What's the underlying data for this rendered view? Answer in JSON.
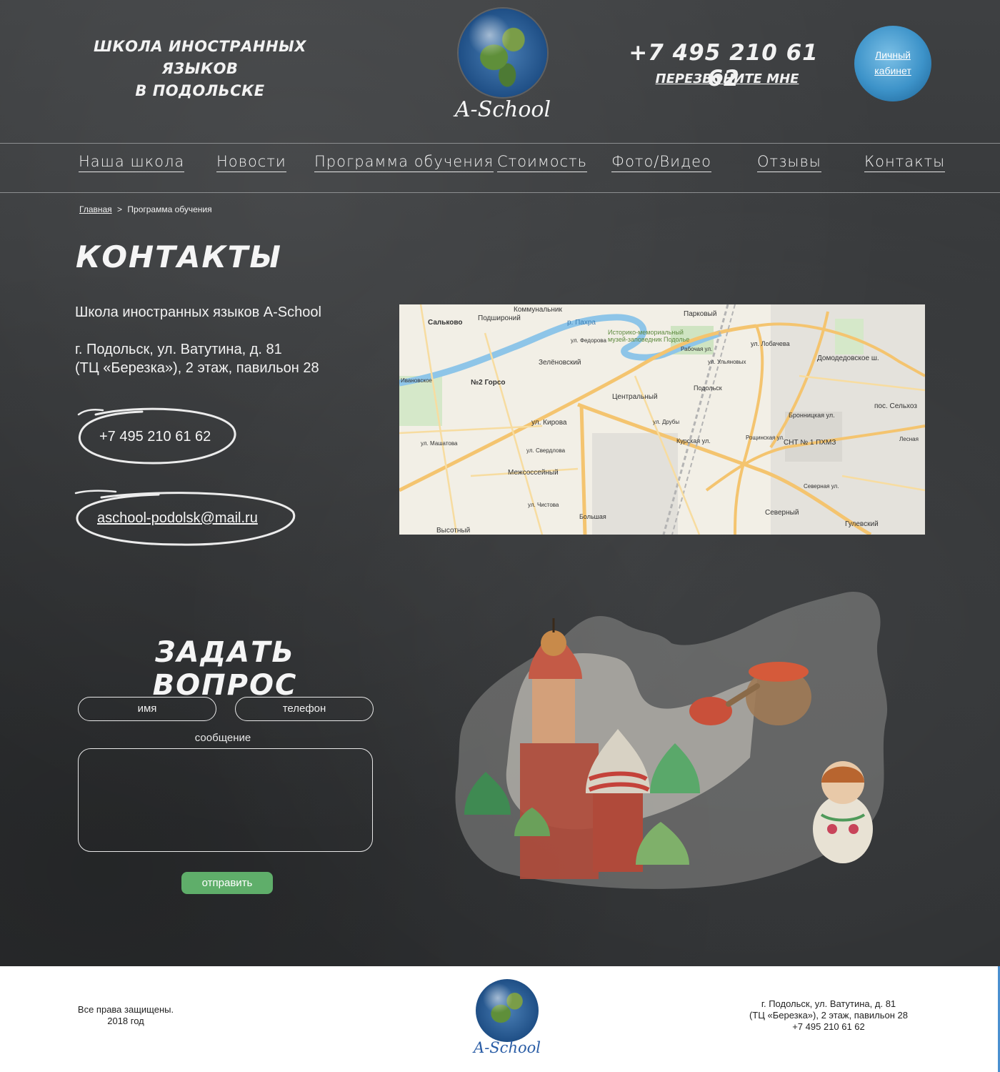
{
  "header": {
    "tagline_line1": "ШКОЛА ИНОСТРАННЫХ ЯЗЫКОВ",
    "tagline_line2": "В ПОДОЛЬСКЕ",
    "logo_text": "A-School",
    "phone": "+7  495 210 61 62",
    "callback": "ПЕРЕЗВОНИТЕ МНЕ",
    "cabinet_line1": "Личный",
    "cabinet_line2": "кабинет"
  },
  "nav": {
    "items": [
      "Наша школа",
      "Новости",
      "Программа обучения",
      "Стоимость",
      "Фото/Видео",
      "Отзывы",
      "Контакты"
    ]
  },
  "breadcrumb": {
    "home": "Главная",
    "separator": ">",
    "current": "Программа обучения"
  },
  "page": {
    "title": "КОНТАКТЫ",
    "school_name": "Школа иностранных языков A-School",
    "address_line1": "г. Подольск, ул. Ватутина, д. 81",
    "address_line2": "(ТЦ «Березка»), 2 этаж, павильон 28",
    "phone": "+7 495 210 61 62",
    "email": "aschool-podolsk@mail.ru"
  },
  "map": {
    "labels": [
      "Коммунальник",
      "Сальково",
      "Подшироний",
      "р. Пахра",
      "Парковый",
      "Историко-мемориальный",
      "музей-заповедник Подолье",
      "ул. Федорова",
      "Зелёновский",
      "Рабочая ул.",
      "ул. Лобачева",
      "Домодедовское ш.",
      "№2 Горсо",
      "Центральный",
      "Подольск",
      "Бронницкая ул.",
      "пос. Сельхоз",
      "ул. Кирова",
      "ул. Друбы",
      "Курская ул.",
      "Рощинская ул.",
      "Межсоссейный",
      "СНТ № 1 ПХМЗ",
      "Лесная",
      "ул. Свердлова",
      "ул. Машатова",
      "ул. Чистова",
      "Большая",
      "Северный",
      "Гулевский",
      "Высотный",
      "ул. Ульяновых",
      "Северная ул.",
      "Ивановское"
    ]
  },
  "form": {
    "title": "ЗАДАТЬ ВОПРОС",
    "name_placeholder": "имя",
    "phone_placeholder": "телефон",
    "message_label": "сообщение",
    "submit": "отправить"
  },
  "footer": {
    "rights_line1": "Все права защищены.",
    "rights_line2": "2018 год",
    "logo_text": "A-School",
    "address_line1": "г. Подольск, ул. Ватутина, д. 81",
    "address_line2": "(ТЦ «Березка»), 2 этаж, павильон 28",
    "phone": "+7 495 210 61 62"
  },
  "colors": {
    "board": "#35373a",
    "accent_green": "#5fae6a",
    "cabinet_blue": "#3d93c9",
    "road": "#f4c46f"
  }
}
